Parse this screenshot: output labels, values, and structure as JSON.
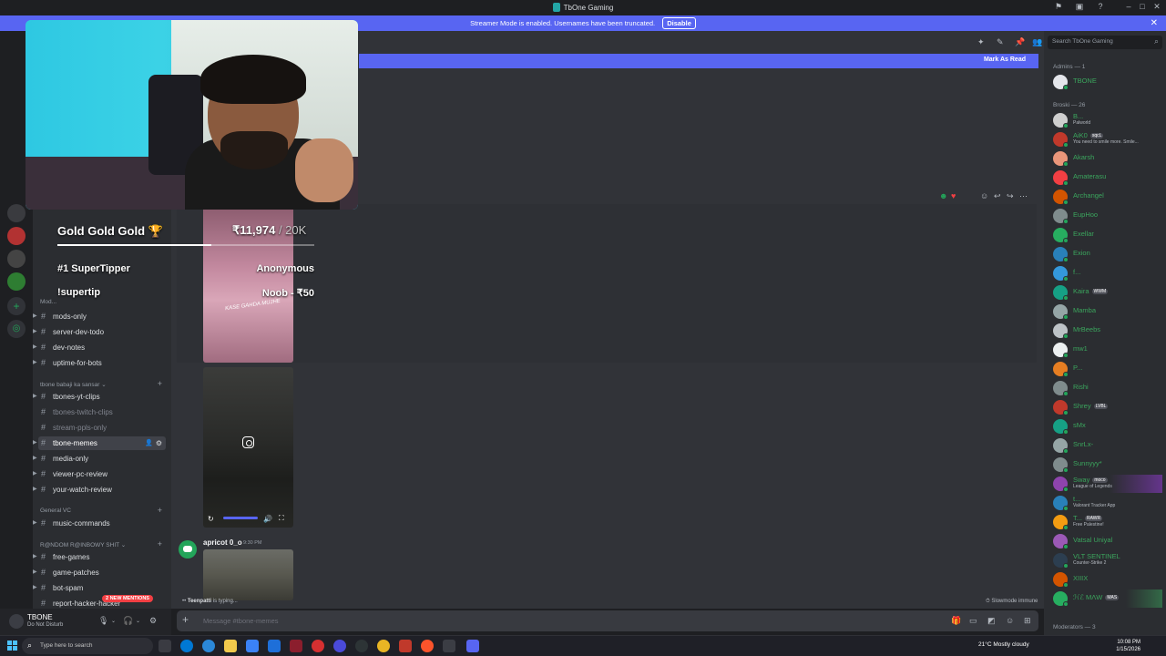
{
  "window": {
    "title": "TbOne Gaming"
  },
  "banner": {
    "text": "Streamer Mode is enabled. Usernames have been truncated.",
    "disable_label": "Disable"
  },
  "sidebar": {
    "categories": [
      {
        "label": "Mod..."
      },
      {
        "label": "tbone babaji ka sansar"
      },
      {
        "label": "General VC"
      },
      {
        "label": "R@NDOM R@INBOWY SHIT"
      }
    ],
    "channels": [
      {
        "label": "mods-only"
      },
      {
        "label": "server-dev-todo"
      },
      {
        "label": "dev-notes"
      },
      {
        "label": "uptime-for-bots"
      },
      {
        "label": "tbones-yt-clips"
      },
      {
        "label": "tbones-twitch-clips"
      },
      {
        "label": "stream-ppls-only"
      },
      {
        "label": "tbone-memes"
      },
      {
        "label": "media-only"
      },
      {
        "label": "viewer-pc-review"
      },
      {
        "label": "your-watch-review"
      },
      {
        "label": "music-commands"
      },
      {
        "label": "free-games"
      },
      {
        "label": "game-patches"
      },
      {
        "label": "bot-spam"
      },
      {
        "label": "report-hacker-hacker"
      }
    ],
    "new_mentions": "2 NEW MENTIONS"
  },
  "user": {
    "name": "TBONE",
    "status": "Do Not Disturb"
  },
  "chat": {
    "mark_as_read": "Mark As Read",
    "media1_caption": "KASE GAHDA MUJHE",
    "message2": {
      "author": "apricot 0_o",
      "time": "9:30 PM"
    },
    "typing_user": "Teenpatti",
    "typing_suffix": " is typing...",
    "slowmode": "Slowmode immune",
    "composer_placeholder": "Message #tbone-memes"
  },
  "members": {
    "search_placeholder": "Search TbOne Gaming",
    "admins_header": "Admins — 1",
    "admins": [
      {
        "name": "TBONE",
        "color": "#3ba55d"
      }
    ],
    "broski_header": "Broski — 26",
    "broski": [
      {
        "name": "B...",
        "sub": "Palworld",
        "color": "#3ba55d"
      },
      {
        "name": "AiK0",
        "tag": "sqcL",
        "sub": "You need to smile more. Smile...",
        "color": "#3ba55d"
      },
      {
        "name": "Akarsh",
        "color": "#3ba55d"
      },
      {
        "name": "Amaterasu",
        "color": "#3ba55d"
      },
      {
        "name": "Archangel",
        "color": "#3ba55d"
      },
      {
        "name": "EupHoo",
        "color": "#3ba55d"
      },
      {
        "name": "Exellar",
        "color": "#3ba55d"
      },
      {
        "name": "Exion",
        "color": "#3ba55d"
      },
      {
        "name": "f...",
        "color": "#3ba55d"
      },
      {
        "name": "Kaira",
        "tag": "WWM",
        "color": "#3ba55d"
      },
      {
        "name": "Mamba",
        "color": "#3ba55d"
      },
      {
        "name": "MrBeebs",
        "color": "#3ba55d"
      },
      {
        "name": "mw1",
        "color": "#3ba55d"
      },
      {
        "name": "P...",
        "color": "#3ba55d"
      },
      {
        "name": "Rishi",
        "color": "#3ba55d"
      },
      {
        "name": "Shrey",
        "tag": "LVBL",
        "color": "#3ba55d"
      },
      {
        "name": "sMx",
        "color": "#3ba55d"
      },
      {
        "name": "SnrLx-",
        "color": "#3ba55d"
      },
      {
        "name": "Sunnyyy*",
        "color": "#3ba55d"
      },
      {
        "name": "Sway",
        "tag": "moco",
        "sub": "League of Legends",
        "color": "#3ba55d"
      },
      {
        "name": "t...",
        "sub": "Valorant Tracker App",
        "color": "#3ba55d"
      },
      {
        "name": "T...",
        "tag": "RAWR",
        "sub": "Free Palestine!",
        "color": "#3ba55d"
      },
      {
        "name": "Vatsal Uniyal",
        "color": "#3ba55d"
      },
      {
        "name": "VLT SENTINEL",
        "sub": "Counter-Strike 2",
        "color": "#3ba55d"
      },
      {
        "name": "XIIIX",
        "color": "#3ba55d"
      },
      {
        "name": "ℋℰ MΛW",
        "tag": "MAS",
        "color": "#3ba55d"
      }
    ],
    "moderators_header": "Moderators — 3"
  },
  "overlay": {
    "goal_title": "Gold Gold Gold 🏆",
    "goal_amount": "₹11,974",
    "goal_target": " / 20K",
    "goal_progress": 0.5987,
    "row1_label": "#1 SuperTipper",
    "row1_value": "Anonymous",
    "row2_label": "!supertip",
    "row2_value": "Noob - ₹50"
  },
  "taskbar": {
    "search_placeholder": "Type here to search",
    "weather": "21°C  Mostly cloudy",
    "time": "10:08 PM",
    "date": "1/15/2026"
  }
}
